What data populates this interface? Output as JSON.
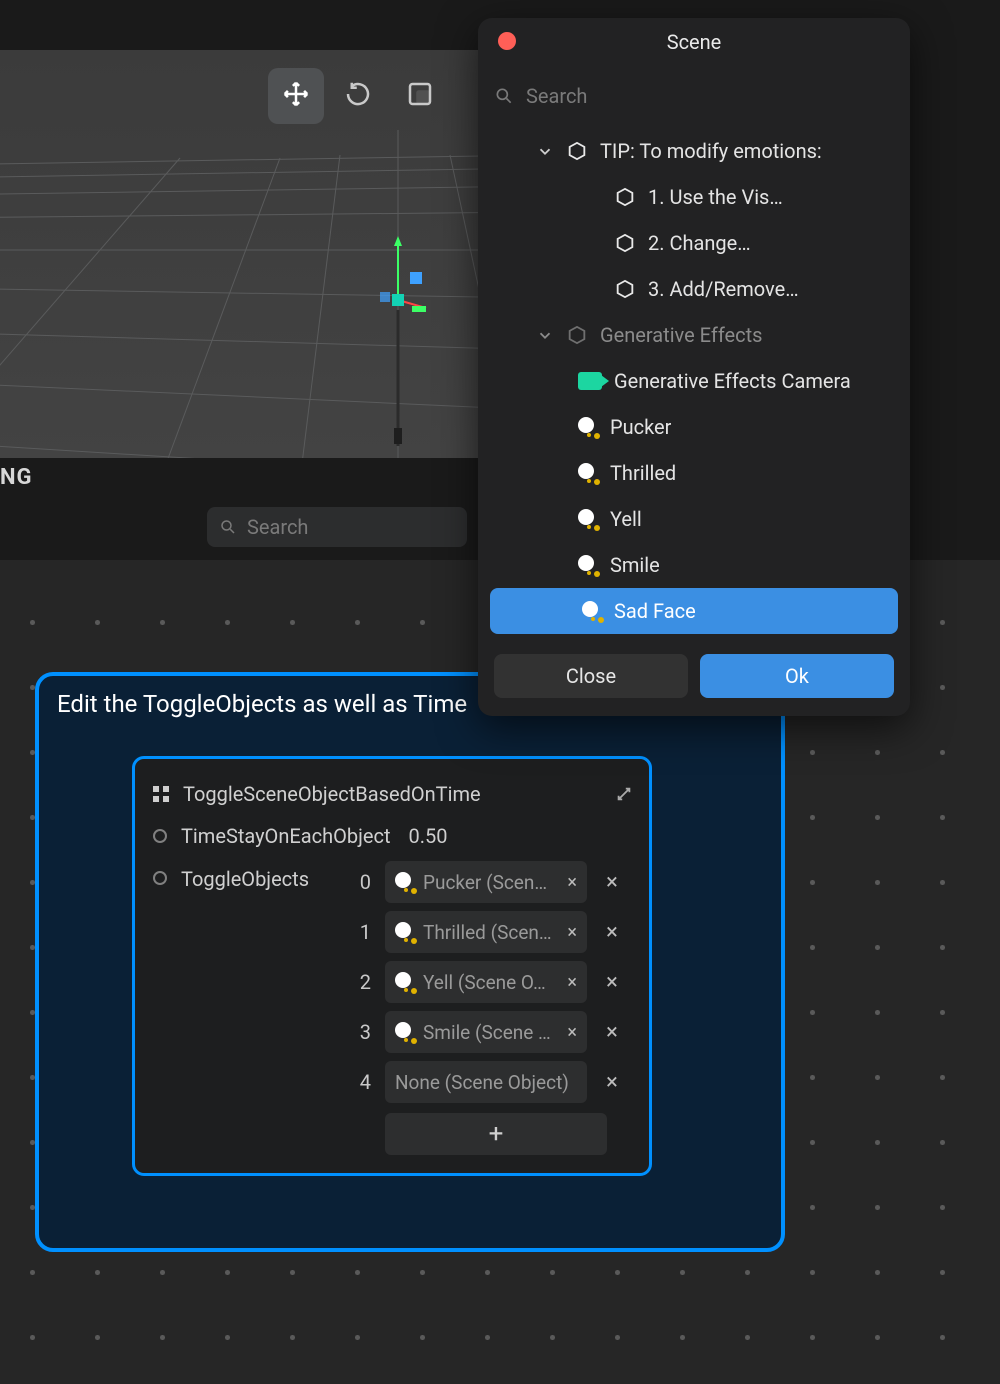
{
  "viewport": {
    "status_tag": "NG",
    "search_placeholder": "Search",
    "tools": {
      "move": "Move",
      "rotate": "Rotate",
      "scale": "Scale"
    }
  },
  "annotation": {
    "title_prefix": "Edit the ToggleObjects as well as ",
    "title_emph": "Time"
  },
  "node": {
    "title": "ToggleSceneObjectBasedOnTime",
    "time_label": "TimeStayOnEachObject",
    "time_value": "0.50",
    "list_label": "ToggleObjects",
    "items": [
      {
        "idx": "0",
        "label": "Pucker (Scen…"
      },
      {
        "idx": "1",
        "label": "Thrilled (Scen…"
      },
      {
        "idx": "2",
        "label": "Yell (Scene O…"
      },
      {
        "idx": "3",
        "label": "Smile (Scene …"
      }
    ],
    "placeholder_idx": "4",
    "placeholder_label": "None (Scene Object)",
    "add_label": "+"
  },
  "popup": {
    "title": "Scene",
    "search_placeholder": "Search",
    "tip_root": "TIP: To modify emotions:",
    "tip_children": [
      "1. Use the Vis…",
      "2. Change…",
      "3. Add/Remove…"
    ],
    "gen_root": "Generative Effects",
    "gen_camera": "Generative Effects Camera",
    "emotions": [
      "Pucker",
      "Thrilled",
      "Yell",
      "Smile"
    ],
    "selected": "Sad Face",
    "close": "Close",
    "ok": "Ok"
  }
}
